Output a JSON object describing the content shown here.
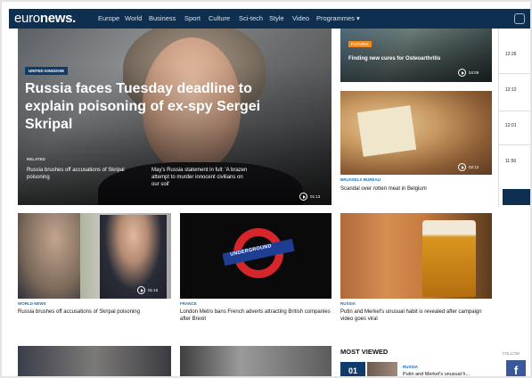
{
  "header": {
    "logo_main": "euro",
    "logo_accent": "news.",
    "nav": [
      "Europe",
      "World",
      "Business",
      "Sport",
      "Culture",
      "Sci-tech",
      "Style",
      "Video",
      "Programmes ▾"
    ]
  },
  "hero": {
    "tag": "UNITED KINGDOM",
    "title": "Russia faces Tuesday deadline to explain poisoning of ex-spy Sergei Skripal",
    "related_label": "RELATED",
    "related": [
      "Russia brushes off accusations of Skripal poisoning",
      "May's Russia statement in full: 'A brazen attempt to murder innocent civilians on our soil'"
    ],
    "duration": "01:13"
  },
  "right_column": [
    {
      "tag": "FUTURIS",
      "title": "Finding new cures for Osteoarthritis",
      "duration": "04:09"
    },
    {
      "tag": "BRUSSELS BUREAU",
      "title": "Scandal over rotten meat in Belgium",
      "duration": "02:12"
    }
  ],
  "middle_row": [
    {
      "tag": "WORLD NEWS",
      "title": "Russia brushes off accusations of Skripal poisoning",
      "duration": "01:15"
    },
    {
      "tag": "FRANCE",
      "title": "London Metro bans French adverts attracting British companies after Brexit",
      "overlay": "UNDERGROUND"
    },
    {
      "tag": "RUSSIA",
      "title": "Putin and Merkel's unusual habit is revealed after campaign video goes viral"
    }
  ],
  "most_viewed": {
    "heading": "MOST VIEWED",
    "number": "01",
    "tag": "RUSSIA",
    "text": "Putin and Merkel's unusual h..."
  },
  "timeline": {
    "times": [
      "12:26",
      "12:12",
      "12:01",
      "11:56"
    ]
  },
  "follow": {
    "label": "FOLLOW",
    "fb": "f"
  },
  "colors": {
    "navbar": "#0e2f4f",
    "accent_blue": "#1b6fb8",
    "tag_orange": "#f08a1c"
  }
}
